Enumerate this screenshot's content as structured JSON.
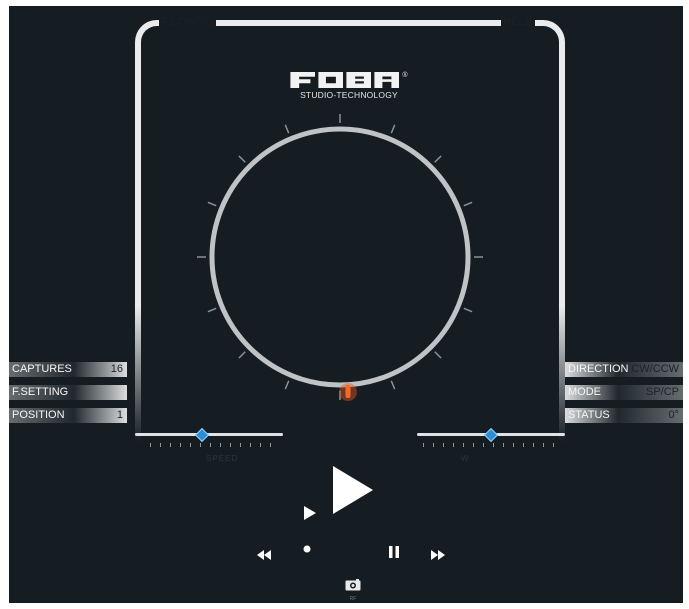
{
  "header": {
    "config_label": "F.CONFIG",
    "help_label": "HELP"
  },
  "logo": {
    "registered": "®",
    "subtitle": "STUDIO-TECHNOLOGY"
  },
  "left_panel": {
    "captures": {
      "label": "CAPTURES",
      "value": "16"
    },
    "f_setting": {
      "label": "F.SETTING",
      "value": ""
    },
    "position": {
      "label": "POSITION",
      "value": "1"
    }
  },
  "right_panel": {
    "direction": {
      "label": "DIRECTION",
      "value": "CW/CCW"
    },
    "mode": {
      "label": "MODE",
      "value": "SP/CP"
    },
    "status": {
      "label": "STATUS",
      "value": "0°"
    }
  },
  "sliders": {
    "left": {
      "level": 0.45,
      "caption": "SPEED"
    },
    "right": {
      "level": 0.5,
      "caption": "W"
    }
  },
  "turntable": {
    "indicator_angle_deg": 0,
    "indicator_color": "#e2561c"
  },
  "controls": {
    "play_icon": "play-icon",
    "small_play_icon": "play-small-icon",
    "rewind_icon": "rewind-icon",
    "record_icon": "record-dot-icon",
    "pause_icon": "pause-icon",
    "forward_icon": "fast-forward-icon",
    "camera_icon": "camera-icon",
    "camera_caption": "RF"
  },
  "colors": {
    "background": "#151d22",
    "frame": "#e9ebec",
    "accent_blue": "#2b8ed6"
  }
}
